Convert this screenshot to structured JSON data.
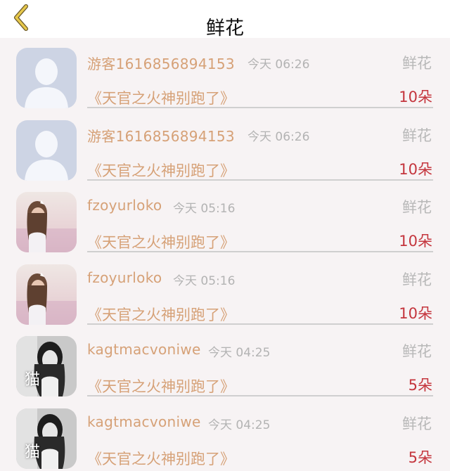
{
  "header": {
    "title": "鲜花",
    "back_icon": "chevron-left-icon",
    "accent_color": "#e7c84b"
  },
  "colors": {
    "username": "#d6a177",
    "count": "#c4353d",
    "muted": "#b3b3b3"
  },
  "rows": [
    {
      "username": "游客1616856894153",
      "time": "今天 06:26",
      "gift_type": "鲜花",
      "work_title": "《天官之火神别跑了》",
      "count": "10朵",
      "avatar": "default-avatar"
    },
    {
      "username": "游客1616856894153",
      "time": "今天 06:26",
      "gift_type": "鲜花",
      "work_title": "《天官之火神别跑了》",
      "count": "10朵",
      "avatar": "default-avatar"
    },
    {
      "username": "fzoyurloko",
      "time": "今天 05:16",
      "gift_type": "鲜花",
      "work_title": "《天官之火神别跑了》",
      "count": "10朵",
      "avatar": "photo-avatar-girl-field"
    },
    {
      "username": "fzoyurloko",
      "time": "今天 05:16",
      "gift_type": "鲜花",
      "work_title": "《天官之火神别跑了》",
      "count": "10朵",
      "avatar": "photo-avatar-girl-field"
    },
    {
      "username": "kagtmacvoniwe",
      "time": "今天 04:25",
      "gift_type": "鲜花",
      "work_title": "《天官之火神别跑了》",
      "count": "5朵",
      "avatar": "photo-avatar-bw-cat",
      "avatar_badge": "猫"
    },
    {
      "username": "kagtmacvoniwe",
      "time": "今天 04:25",
      "gift_type": "鲜花",
      "work_title": "《天官之火神别跑了》",
      "count": "5朵",
      "avatar": "photo-avatar-bw-cat",
      "avatar_badge": "猫"
    }
  ]
}
